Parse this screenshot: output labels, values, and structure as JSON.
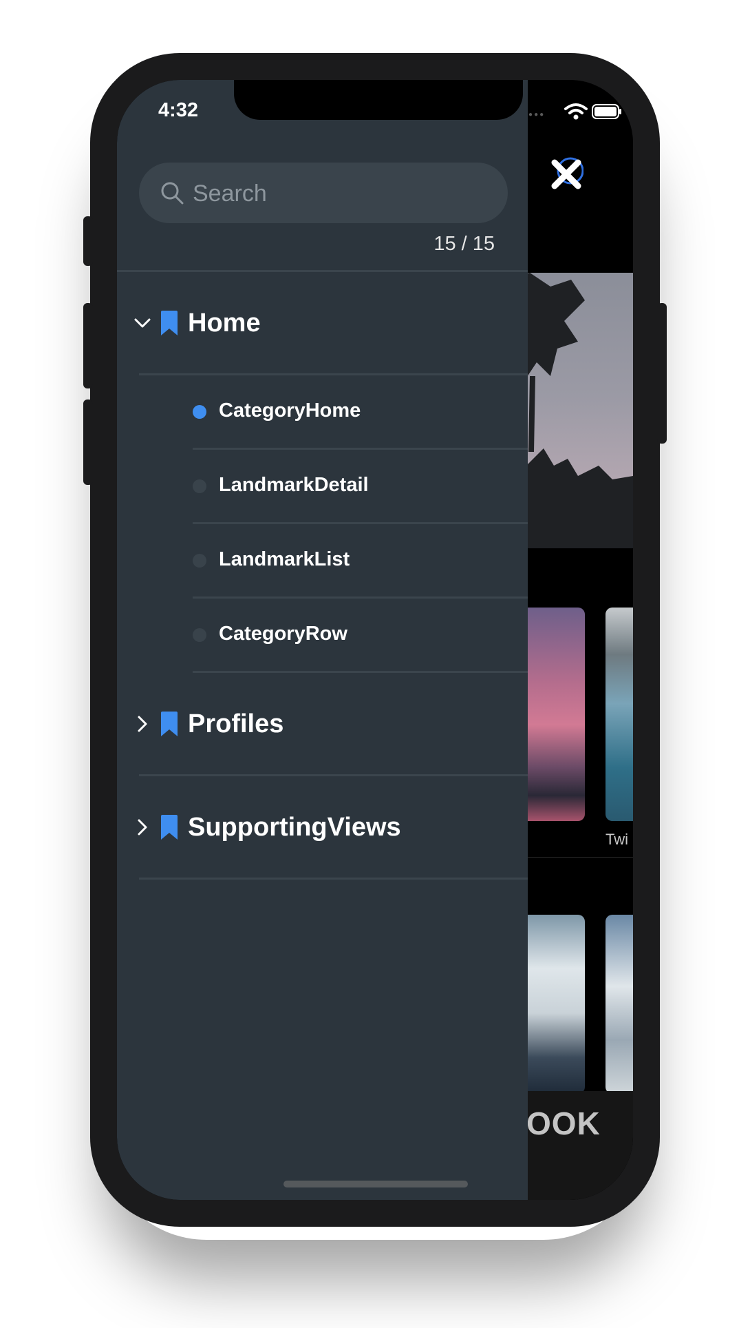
{
  "status_bar": {
    "time": "4:32"
  },
  "search": {
    "placeholder": "Search",
    "value": ""
  },
  "result_count": "15 / 15",
  "groups": [
    {
      "label": "Home",
      "expanded": true,
      "items": [
        {
          "label": "CategoryHome",
          "active": true
        },
        {
          "label": "LandmarkDetail",
          "active": false
        },
        {
          "label": "LandmarkList",
          "active": false
        },
        {
          "label": "CategoryRow",
          "active": false
        }
      ]
    },
    {
      "label": "Profiles",
      "expanded": false,
      "items": []
    },
    {
      "label": "SupportingViews",
      "expanded": false,
      "items": []
    }
  ],
  "background_app": {
    "caption": "Twi",
    "tab_text": "OOK"
  },
  "colors": {
    "drawer_bg": "#2c353d",
    "accent": "#3f8ef0",
    "inactive_dot": "#39434b"
  },
  "icons": {
    "search": "search-icon",
    "expanded": "chevron-down-icon",
    "collapsed": "chevron-right-icon",
    "group": "bookmark-icon",
    "close": "close-icon"
  }
}
